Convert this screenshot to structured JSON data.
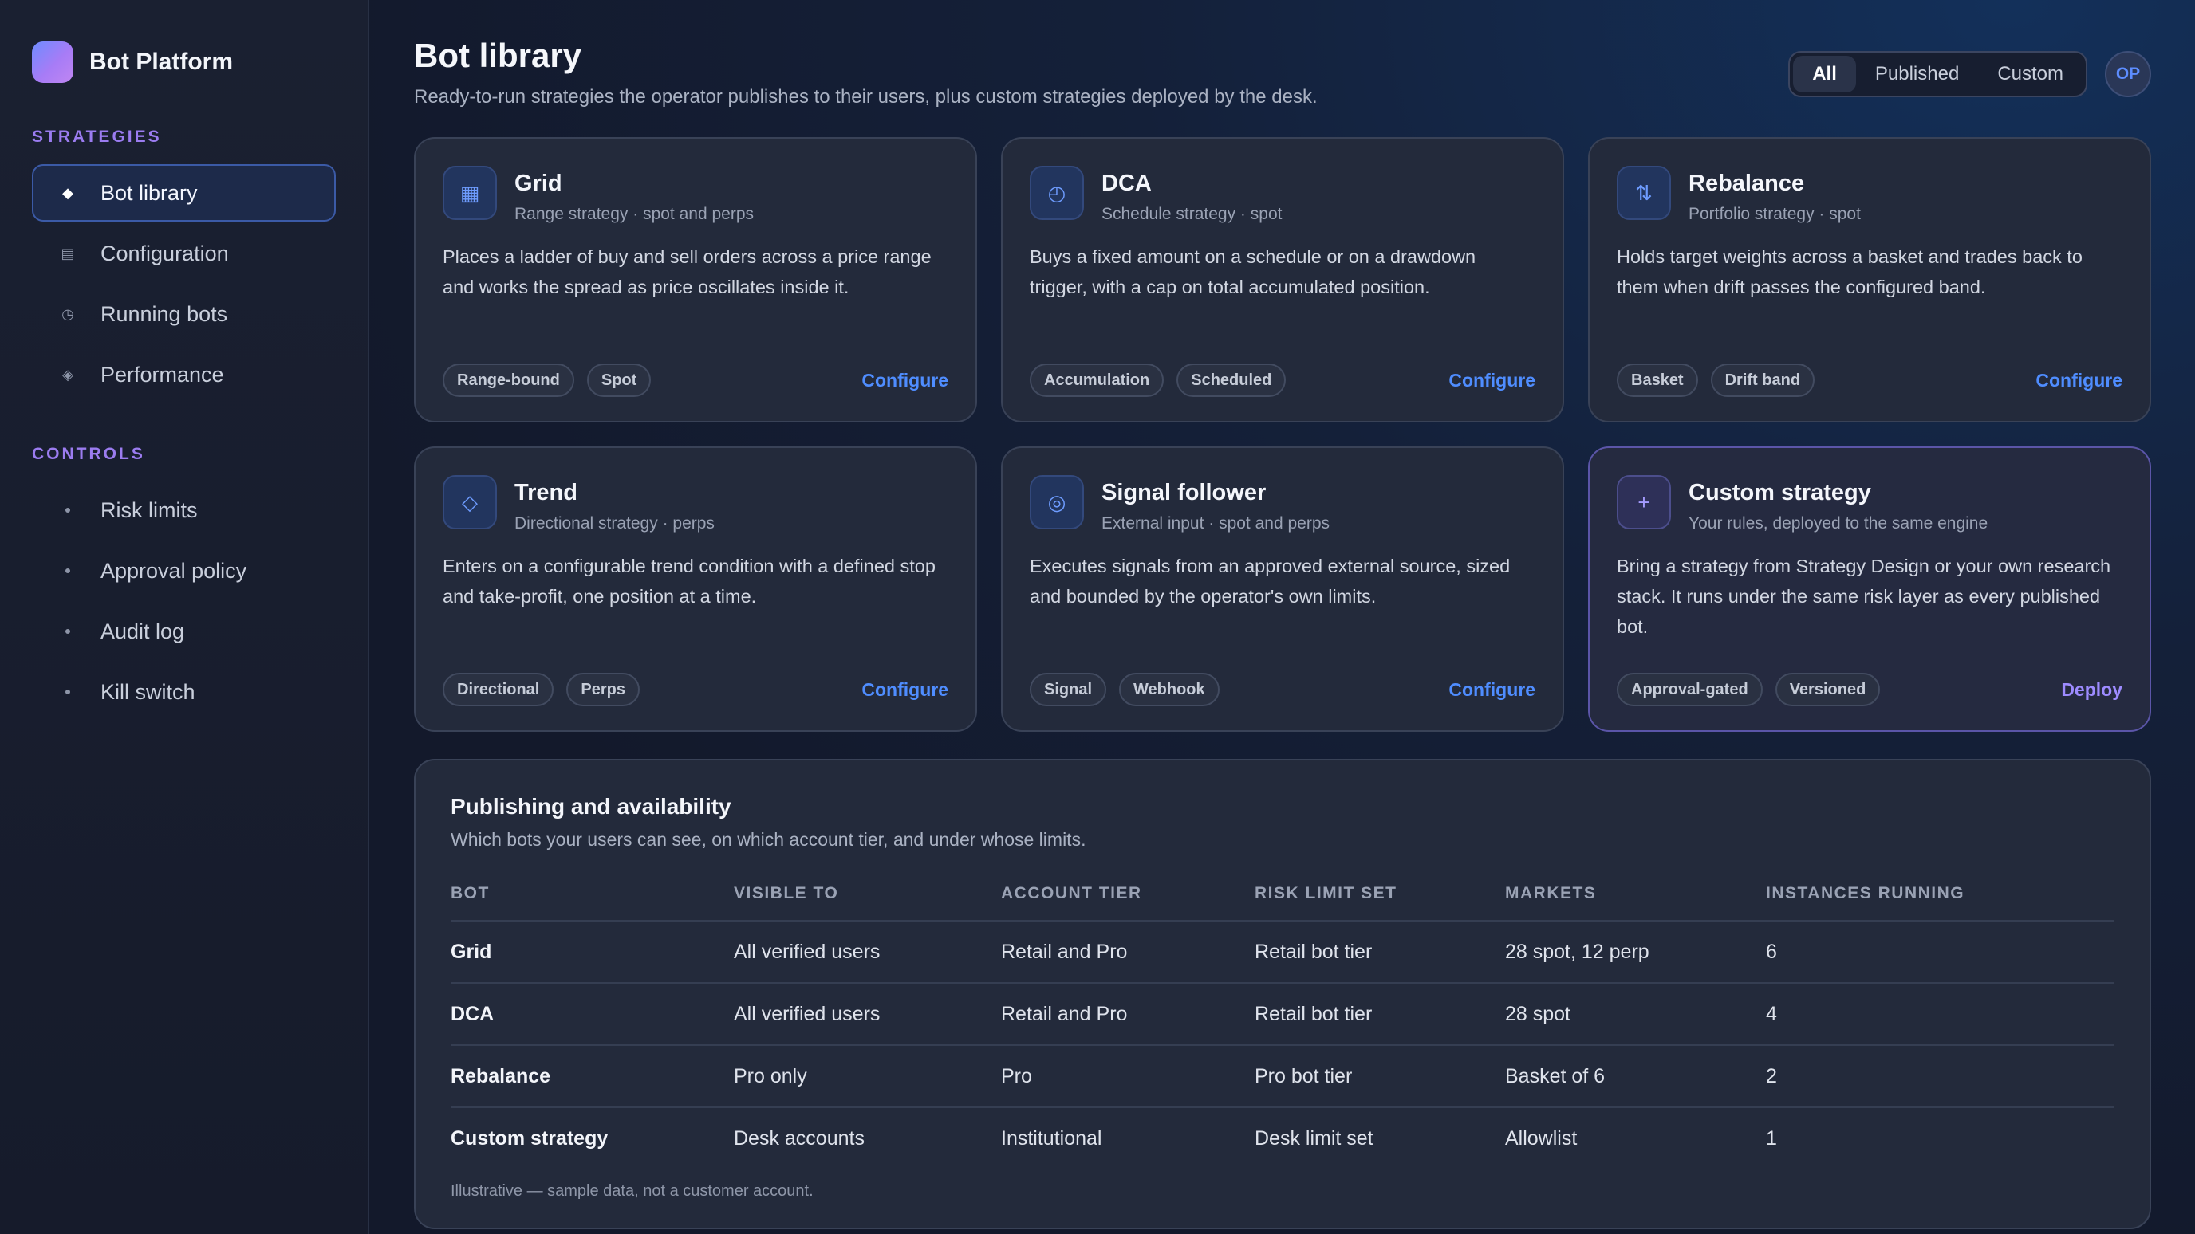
{
  "brand": {
    "name": "Bot Platform"
  },
  "sidebar": {
    "strategies_label": "STRATEGIES",
    "strategies": [
      {
        "label": "Bot library",
        "icon": "diamond-icon",
        "active": true
      },
      {
        "label": "Configuration",
        "icon": "list-icon",
        "active": false
      },
      {
        "label": "Running bots",
        "icon": "clock-icon",
        "active": false
      },
      {
        "label": "Performance",
        "icon": "diamond-outline-icon",
        "active": false
      }
    ],
    "controls_label": "CONTROLS",
    "controls": [
      {
        "label": "Risk limits"
      },
      {
        "label": "Approval policy"
      },
      {
        "label": "Audit log"
      },
      {
        "label": "Kill switch"
      }
    ]
  },
  "header": {
    "title": "Bot library",
    "subtitle": "Ready-to-run strategies the operator publishes to their users, plus custom strategies deployed by the desk.",
    "filters": [
      "All",
      "Published",
      "Custom"
    ],
    "active_filter": "All",
    "avatar": "OP"
  },
  "cards": [
    {
      "title": "Grid",
      "subtitle": "Range strategy · spot and perps",
      "icon": "grid-icon",
      "description": "Places a ladder of buy and sell orders across a price range and works the spread as price oscillates inside it.",
      "tags": [
        "Range-bound",
        "Spot"
      ],
      "action": "Configure"
    },
    {
      "title": "DCA",
      "subtitle": "Schedule strategy · spot",
      "icon": "clock-icon",
      "description": "Buys a fixed amount on a schedule or on a drawdown trigger, with a cap on total accumulated position.",
      "tags": [
        "Accumulation",
        "Scheduled"
      ],
      "action": "Configure"
    },
    {
      "title": "Rebalance",
      "subtitle": "Portfolio strategy · spot",
      "icon": "swap-arrows-icon",
      "description": "Holds target weights across a basket and trades back to them when drift passes the configured band.",
      "tags": [
        "Basket",
        "Drift band"
      ],
      "action": "Configure"
    },
    {
      "title": "Trend",
      "subtitle": "Directional strategy · perps",
      "icon": "diamond-icon",
      "description": "Enters on a configurable trend condition with a defined stop and take-profit, one position at a time.",
      "tags": [
        "Directional",
        "Perps"
      ],
      "action": "Configure"
    },
    {
      "title": "Signal follower",
      "subtitle": "External input · spot and perps",
      "icon": "target-icon",
      "description": "Executes signals from an approved external source, sized and bounded by the operator's own limits.",
      "tags": [
        "Signal",
        "Webhook"
      ],
      "action": "Configure"
    },
    {
      "title": "Custom strategy",
      "subtitle": "Your rules, deployed to the same engine",
      "icon": "plus-icon",
      "description": "Bring a strategy from Strategy Design or your own research stack. It runs under the same risk layer as every published bot.",
      "tags": [
        "Approval-gated",
        "Versioned"
      ],
      "action": "Deploy"
    }
  ],
  "publishing": {
    "title": "Publishing and availability",
    "subtitle": "Which bots your users can see, on which account tier, and under whose limits.",
    "columns": [
      "BOT",
      "VISIBLE TO",
      "ACCOUNT TIER",
      "RISK LIMIT SET",
      "MARKETS",
      "INSTANCES RUNNING"
    ],
    "rows": [
      [
        "Grid",
        "All verified users",
        "Retail and Pro",
        "Retail bot tier",
        "28 spot, 12 perp",
        "6"
      ],
      [
        "DCA",
        "All verified users",
        "Retail and Pro",
        "Retail bot tier",
        "28 spot",
        "4"
      ],
      [
        "Rebalance",
        "Pro only",
        "Pro",
        "Pro bot tier",
        "Basket of 6",
        "2"
      ],
      [
        "Custom strategy",
        "Desk accounts",
        "Institutional",
        "Desk limit set",
        "Allowlist",
        "1"
      ]
    ],
    "footnote": "Illustrative — sample data, not a customer account."
  }
}
